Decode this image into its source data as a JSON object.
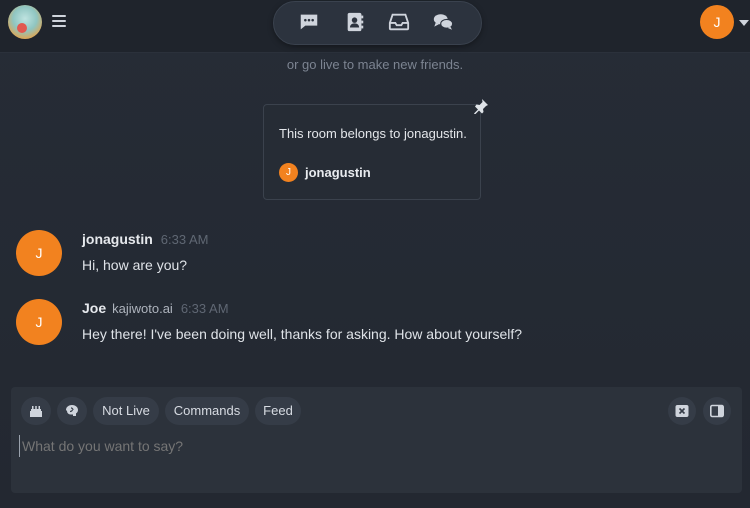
{
  "header": {
    "avatar_initial": "J",
    "nav_icons": [
      "chat-bubble-icon",
      "contact-book-icon",
      "inbox-tray-icon",
      "conversations-icon"
    ]
  },
  "room": {
    "hint": "or go live to make new friends.",
    "pinned": {
      "text": "This room belongs to jonagustin.",
      "owner_initial": "J",
      "owner_name": "jonagustin"
    }
  },
  "messages": [
    {
      "initial": "J",
      "name": "jonagustin",
      "tag": "",
      "time": "6:33 AM",
      "text": "Hi, how are you?"
    },
    {
      "initial": "J",
      "name": "Joe",
      "tag": "kajiwoto.ai",
      "time": "6:33 AM",
      "text": "Hey there! I've been doing well, thanks for asking. How about yourself?"
    }
  ],
  "composer": {
    "chips": [
      "Not Live",
      "Commands",
      "Feed"
    ],
    "placeholder": "What do you want to say?"
  },
  "colors": {
    "accent": "#f2821f",
    "background": "#232831",
    "surface": "#2c323b"
  }
}
